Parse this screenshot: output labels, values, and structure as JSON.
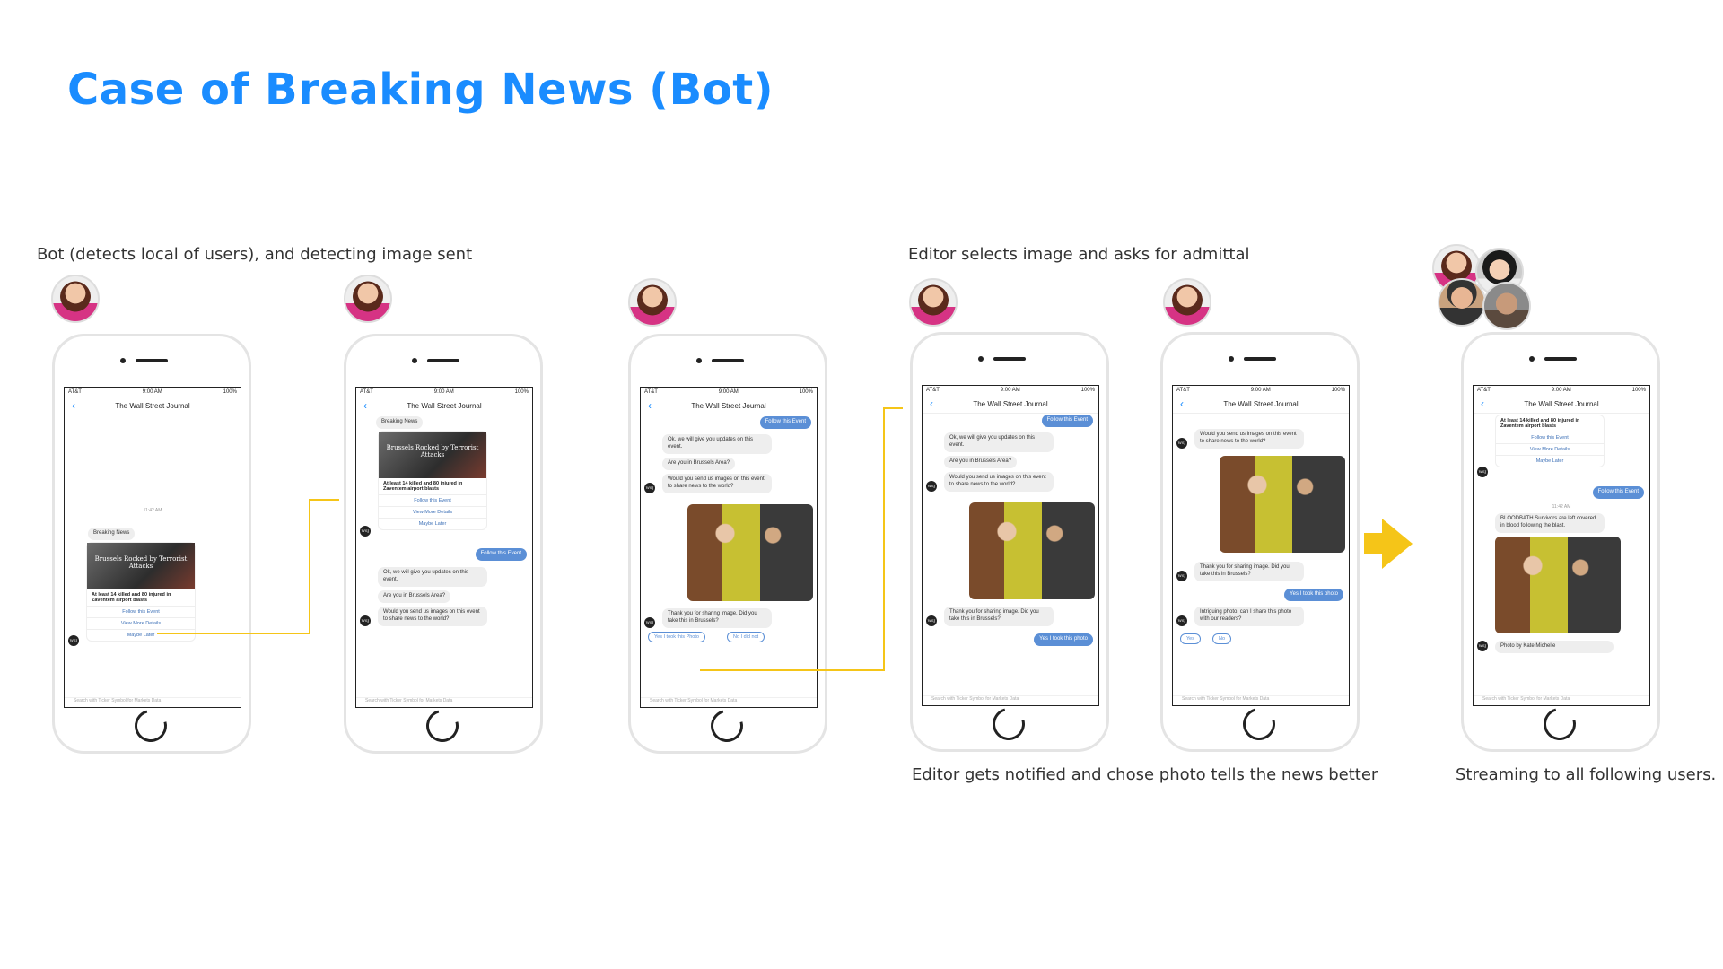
{
  "title": "Case of Breaking News (Bot)",
  "captions": {
    "bot_detect": "Bot (detects local of users), and detecting image sent",
    "editor_selects": "Editor selects image and asks for admittal",
    "editor_notified": "Editor gets notified and chose photo tells the news better",
    "streaming": "Streaming to all following users."
  },
  "phone": {
    "carrier": "AT&T",
    "time": "9:00 AM",
    "battery": "100%",
    "chat_title": "The Wall Street Journal",
    "footer": "Search with Ticker Symbol for Markets Data",
    "avatar_initials": "WSJ"
  },
  "messages": {
    "timestamp": "11:42 AM",
    "breaking_news": "Breaking News",
    "headline_image": "Brussels Rocked by Terrorist Attacks",
    "headline": "At least 14 killed and 80 injured in Zaventem airport blasts",
    "follow": "Follow this Event",
    "more": "View More Details",
    "later": "Maybe Later",
    "ok_updates": "Ok, we will give you updates on this event.",
    "are_you": "Are you in Brussels Area?",
    "send_images": "Would you send us images on this event to share news to the world?",
    "thanks": "Thank you for sharing image. Did you take this in Brussels?",
    "yes_took": "Yes I took this Photo",
    "no_didnt": "No I did not",
    "yes_took_lower": "Yes I took this photo",
    "intriguing": "Intriguing photo, can I share this photo with our readers?",
    "yes": "Yes",
    "no": "No",
    "bloodbath": "BLOODBATH Survivors are left covered in blood following the blast.",
    "photo_by": "Photo by Kate Michelle"
  },
  "colors": {
    "title": "#1a8cff",
    "accent_arrow": "#f5c518",
    "outgoing_bubble": "#5b8fd6"
  }
}
